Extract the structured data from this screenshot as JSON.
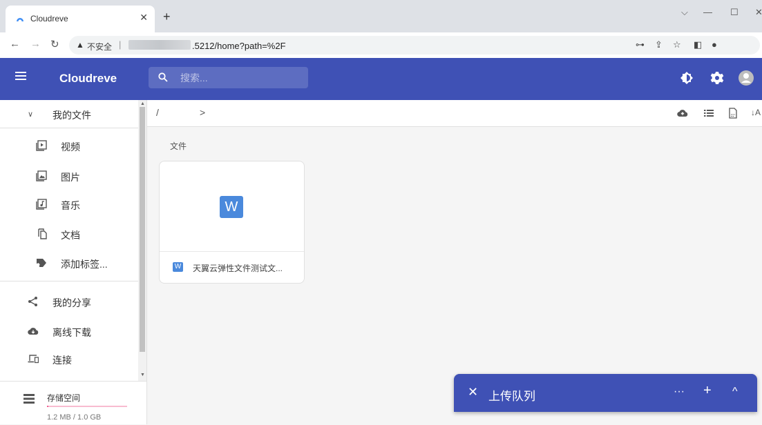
{
  "browser": {
    "tab_title": "Cloudreve",
    "new_tab_icon": "+",
    "address": {
      "security_label": "不安全",
      "url_visible": ".5212/home?path=%2F"
    }
  },
  "app": {
    "title": "Cloudreve",
    "brand_color": "#3f51b5",
    "search_placeholder": "搜索..."
  },
  "sidebar": {
    "my_files": "我的文件",
    "items": [
      {
        "label": "视频",
        "icon": "video-icon"
      },
      {
        "label": "图片",
        "icon": "image-icon"
      },
      {
        "label": "音乐",
        "icon": "music-icon"
      },
      {
        "label": "文档",
        "icon": "document-icon"
      },
      {
        "label": "添加标签...",
        "icon": "add-tag-icon"
      }
    ],
    "share": "我的分享",
    "offline_download": "离线下载",
    "connect": "连接",
    "storage": {
      "title": "存储空间",
      "usage": "1.2 MB / 1.0 GB",
      "fraction_used": 0.0012
    }
  },
  "content": {
    "breadcrumb_root": "/",
    "breadcrumb_arrow": ">",
    "section_label": "文件",
    "files": [
      {
        "name": "天翼云弹性文件测试文...",
        "type_badge": "W"
      }
    ]
  },
  "upload_queue": {
    "title": "上传队列",
    "more": "···",
    "add": "+",
    "collapse": "^"
  }
}
